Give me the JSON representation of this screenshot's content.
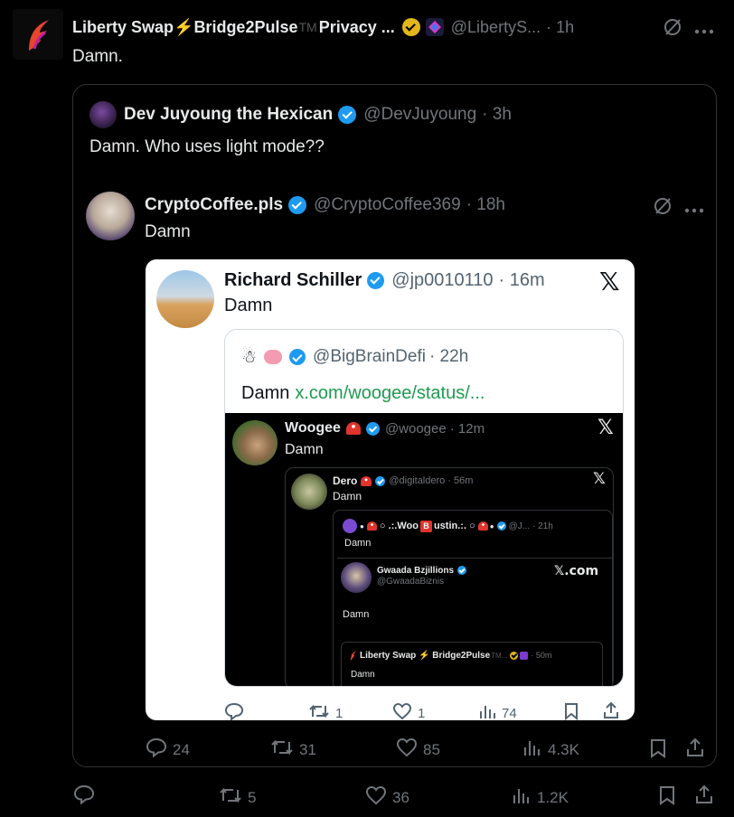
{
  "main_tweet": {
    "display_name": "Liberty Swap⚡Bridge2Pulse",
    "tm": "TM",
    "name_suffix": "Privacy ...",
    "handle": "@LibertyS...",
    "time": "· 1h",
    "text": "Damn.",
    "actions": {
      "replies": "",
      "reposts": "5",
      "likes": "36",
      "views": "1.2K"
    }
  },
  "quote_1": {
    "display_name": "Dev Juyoung the Hexican",
    "handle": "@DevJuyoung",
    "time": "· 3h",
    "text": "Damn. Who uses light mode??"
  },
  "quote_2": {
    "display_name": "CryptoCoffee.pls",
    "handle": "@CryptoCoffee369",
    "time": "· 18h",
    "text": "Damn",
    "actions": {
      "replies": "24",
      "reposts": "31",
      "likes": "85",
      "views": "4.3K"
    }
  },
  "screenshot": {
    "richard": {
      "display_name": "Richard Schiller",
      "handle": "@jp0010110",
      "time": "· 16m",
      "text": "Damn",
      "actions": {
        "replies": "",
        "reposts": "1",
        "likes": "1",
        "views": "74"
      }
    },
    "bigbrain": {
      "handle": "@BigBrainDefi",
      "time": "· 22h",
      "text": "Damn",
      "link": "x.com/woogee/status/..."
    },
    "woogee": {
      "display_name": "Woogee",
      "handle": "@woogee",
      "time": "· 12m",
      "text": "Damn"
    },
    "dero": {
      "display_name": "Dero",
      "handle": "@digitaldero",
      "time": "· 56m",
      "text": "Damn"
    },
    "woobustin": {
      "name_a": "●",
      "name_b": "○ .:.Woo",
      "name_c": "ustin.:. ○",
      "name_d": "●",
      "handle": "@J...",
      "time": "· 21h",
      "text": "Damn"
    },
    "gwaada": {
      "display_name": "Gwaada Bzjillions",
      "handle": "@GwaadaBiznis",
      "brand": "𝕏.com",
      "text": "Damn"
    },
    "liberty_inner": {
      "display_name": "Liberty Swap ⚡ Bridge2Pulse",
      "tm": "TM...",
      "time": "· 50m",
      "text": "Damn"
    }
  }
}
